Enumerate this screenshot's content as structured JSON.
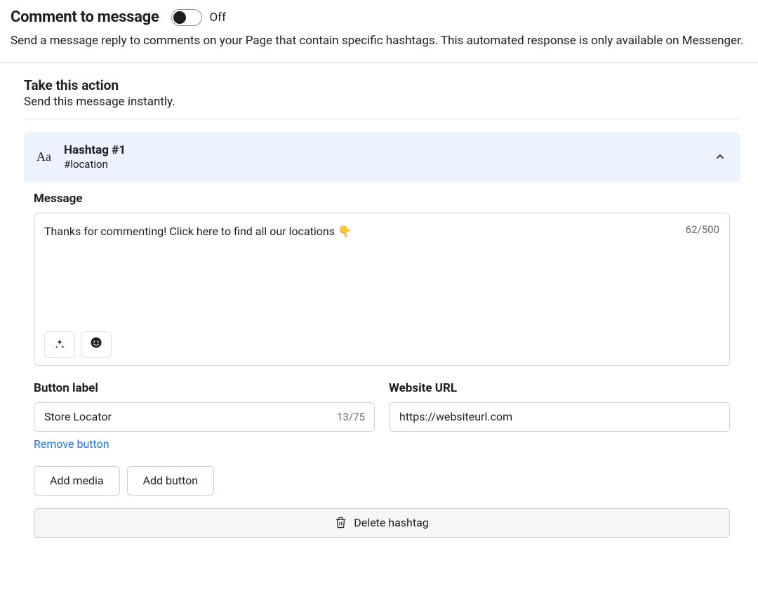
{
  "header": {
    "title": "Comment to message",
    "toggle_state": "Off",
    "description": "Send a message reply to comments on your Page that contain specific hashtags. This automated response is only available on Messenger."
  },
  "action": {
    "title": "Take this action",
    "subtitle": "Send this message instantly."
  },
  "hashtag": {
    "icon_label": "Aa",
    "title": "Hashtag #1",
    "value": "#location"
  },
  "message": {
    "label": "Message",
    "text": "Thanks for commenting! Click here to find all our locations 👇",
    "char_count": "62/500"
  },
  "button_label": {
    "label": "Button label",
    "value": "Store Locator",
    "char_count": "13/75",
    "remove_link": "Remove button"
  },
  "website_url": {
    "label": "Website URL",
    "value": "https://websiteurl.com"
  },
  "buttons": {
    "add_media": "Add media",
    "add_button": "Add button",
    "delete_hashtag": "Delete hashtag"
  }
}
